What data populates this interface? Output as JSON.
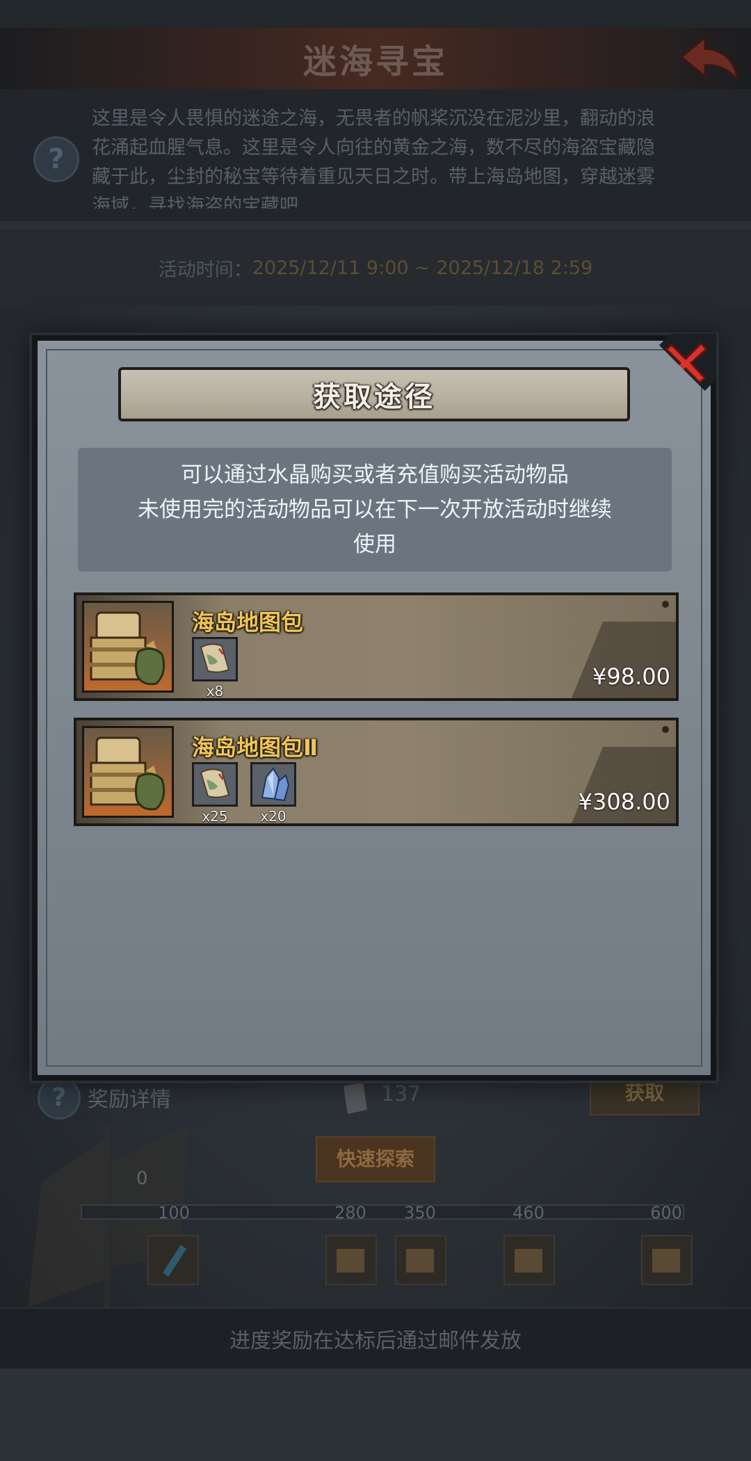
{
  "header": {
    "title": "迷海寻宝",
    "back_icon": "back-arrow-icon"
  },
  "description": {
    "help_icon": "question-mark-icon",
    "text": "这里是令人畏惧的迷途之海，无畏者的帆桨沉没在泥沙里，翻动的浪花涌起血腥气息。这里是令人向往的黄金之海，数不尽的海盗宝藏隐藏于此，尘封的秘宝等待着重见天日之时。带上海岛地图，穿越迷雾海域，寻找海盗的宝藏吧"
  },
  "activity_time": {
    "label": "活动时间：",
    "value": "2025/12/11 9:00 ~ 2025/12/18 2:59"
  },
  "reward": {
    "help_icon": "question-mark-icon",
    "label": "奖励详情",
    "count": "137",
    "get_button": "获取",
    "quick_explore_button": "快速探索",
    "progress_start": "0",
    "milestones": [
      "100",
      "280",
      "350",
      "460",
      "600"
    ]
  },
  "bottom_bar": {
    "text": "进度奖励在达标后通过邮件发放"
  },
  "modal": {
    "title": "获取途径",
    "close_icon": "close-x-icon",
    "info_lines": [
      "可以通过水晶购买或者充值购买活动物品",
      "未使用完的活动物品可以在下一次开放活动时继续",
      "使用"
    ],
    "packs": [
      {
        "name": "海岛地图包",
        "price": "¥98.00",
        "items": [
          {
            "icon": "map-scroll-icon",
            "count": "x8"
          }
        ]
      },
      {
        "name": "海岛地图包Ⅱ",
        "price": "¥308.00",
        "items": [
          {
            "icon": "map-scroll-icon",
            "count": "x25"
          },
          {
            "icon": "crystal-icon",
            "count": "x20"
          }
        ]
      }
    ]
  },
  "colors": {
    "pack_name": "#f1c556",
    "close_red": "#d8322a",
    "time_value": "#5d4d33"
  }
}
